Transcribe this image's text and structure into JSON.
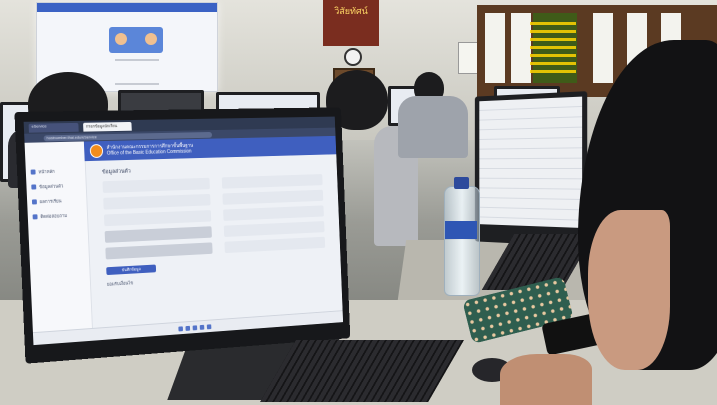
{
  "browser": {
    "tab1": "eService",
    "tab2": "กรอกข้อมูลนักเรียน",
    "url": "hostnumber.thai.edu/eService"
  },
  "app": {
    "title": "สำนักงานคณะกรรมการการศึกษาขั้นพื้นฐาน",
    "subtitle": "Office of the Basic Education Commission"
  },
  "sidebar": {
    "items": [
      "หน้าหลัก",
      "ข้อมูลส่วนตัว",
      "ผลการเรียน",
      "ติดต่อสอบถาม"
    ]
  },
  "form": {
    "section_title": "ข้อมูลส่วนตัว",
    "save_label": "บันทึกข้อมูล",
    "agree_label": "ยอมรับเงื่อนไข"
  },
  "notice_board": {
    "label": "วิสัยทัศน์"
  },
  "colors": {
    "accent": "#3f5fbf",
    "logo": "#f28c1b"
  }
}
